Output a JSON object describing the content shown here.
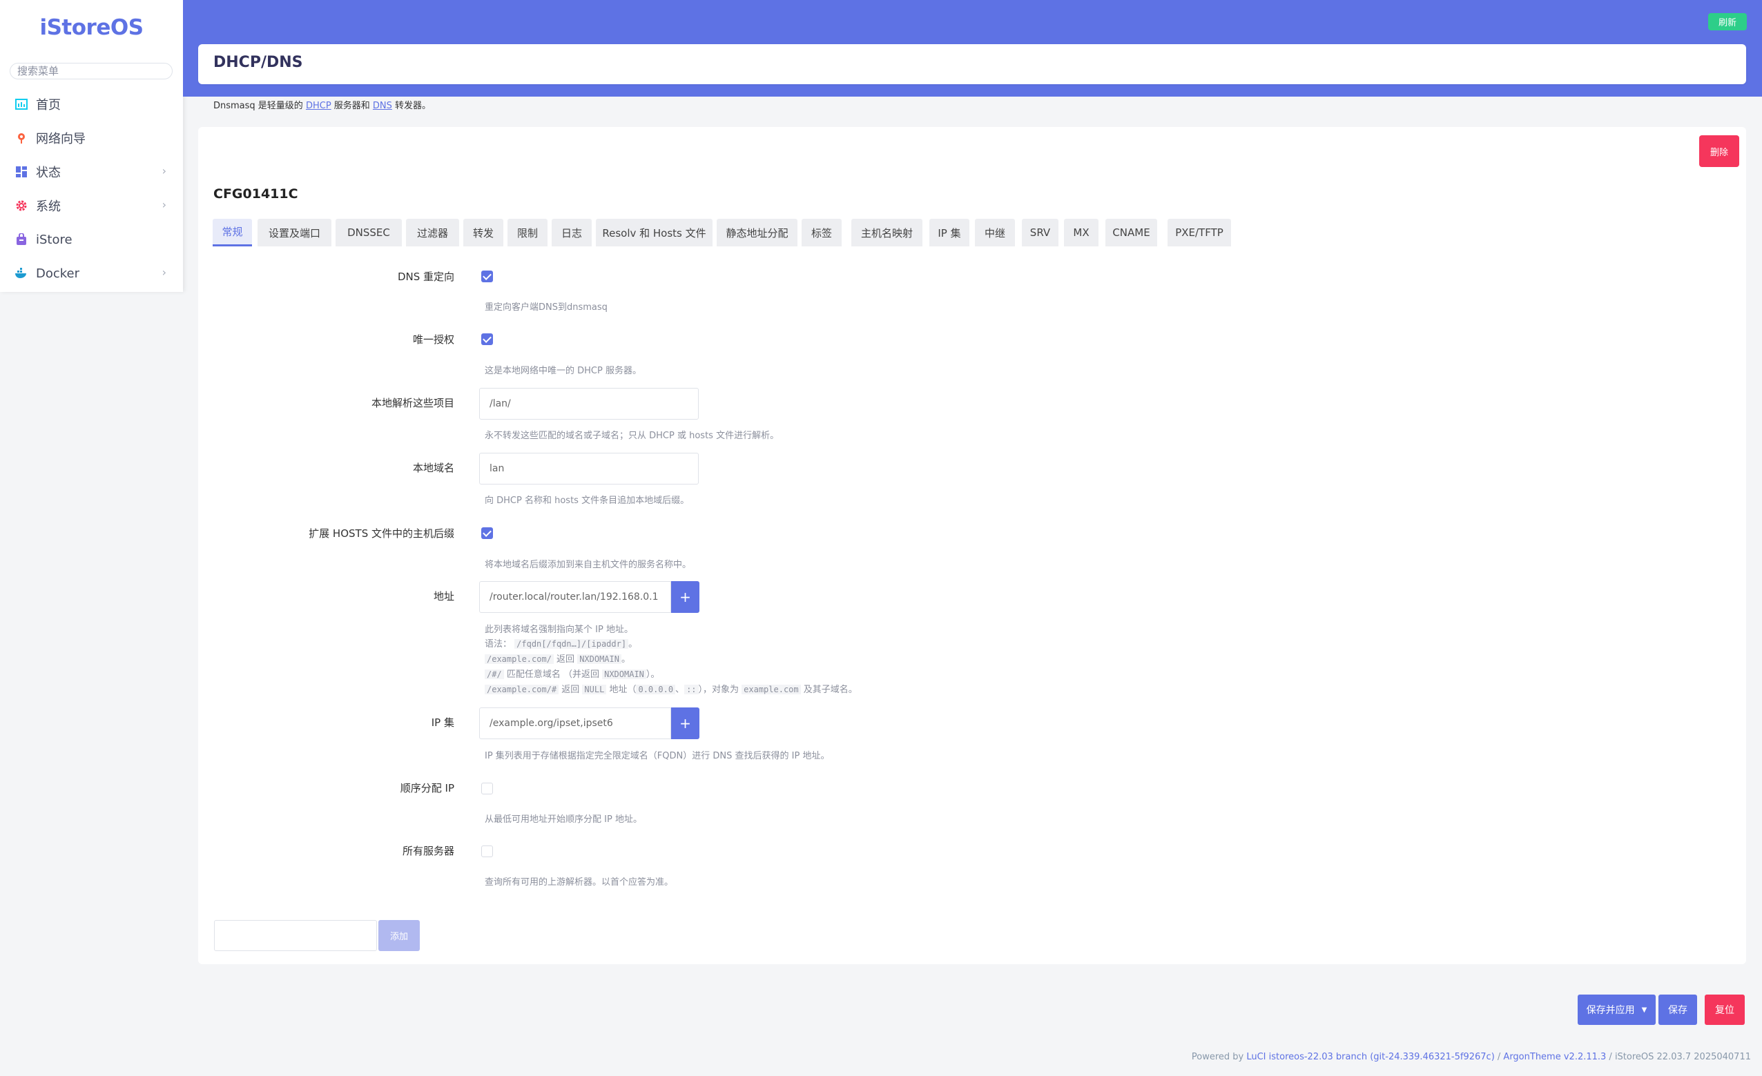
{
  "brand": "iStoreOS",
  "search": {
    "placeholder": "搜索菜单"
  },
  "sidebar": {
    "items": [
      {
        "label": "首页",
        "icon": "home-icon"
      },
      {
        "label": "网络向导",
        "icon": "wizard-icon"
      },
      {
        "label": "状态",
        "icon": "status-icon",
        "expand": true
      },
      {
        "label": "系统",
        "icon": "system-gear-icon",
        "expand": true
      },
      {
        "label": "iStore",
        "icon": "store-icon"
      },
      {
        "label": "Docker",
        "icon": "docker-icon",
        "expand": true
      }
    ]
  },
  "header": {
    "refresh": "刷新",
    "title": "DHCP/DNS"
  },
  "description": {
    "prefix": "Dnsmasq 是轻量级的 ",
    "dhcp": "DHCP",
    "middle": " 服务器和 ",
    "dns": "DNS",
    "suffix": " 转发器。"
  },
  "section": {
    "title": "CFG01411C",
    "delete": "删除"
  },
  "tabs": [
    "常规",
    "设置及端口",
    "DNSSEC",
    "过滤器",
    "转发",
    "限制",
    "日志",
    "Resolv 和 Hosts 文件",
    "静态地址分配",
    "标签",
    "主机名映射",
    "IP 集",
    "中继",
    "SRV",
    "MX",
    "CNAME",
    "PXE/TFTP"
  ],
  "fields": {
    "dns_redirect": {
      "label": "DNS 重定向",
      "checked": true,
      "help": "重定向客户端DNS到dnsmasq"
    },
    "authoritative": {
      "label": "唯一授权",
      "checked": true,
      "help": "这是本地网络中唯一的 DHCP 服务器。"
    },
    "local": {
      "label": "本地解析这些项目",
      "placeholder": "/lan/",
      "help": "永不转发这些匹配的域名或子域名；只从 DHCP 或 hosts 文件进行解析。"
    },
    "domain": {
      "label": "本地域名",
      "placeholder": "lan",
      "help": "向 DHCP 名称和 hosts 文件条目追加本地域后缀。"
    },
    "expandhosts": {
      "label": "扩展 HOSTS 文件中的主机后缀",
      "checked": true,
      "help": "将本地域名后缀添加到来自主机文件的服务名称中。"
    },
    "address": {
      "label": "地址",
      "placeholder": "/router.local/router.lan/192.168.0.1",
      "add": "+",
      "help1": "此列表将域名强制指向某个 IP 地址。",
      "help2_pre": "语法： ",
      "help2_code": "/fqdn[/fqdn…]/[ipaddr]",
      "help2_post": "。",
      "help3_code": "/example.com/",
      "help3_mid": " 返回 ",
      "help3_code2": "NXDOMAIN",
      "help3_post": "。",
      "help4_code": "/#/",
      "help4_mid": " 匹配任意域名 （并返回 ",
      "help4_code2": "NXDOMAIN",
      "help4_post": "）。",
      "help5_code": "/example.com/#",
      "help5_mid": " 返回 ",
      "help5_code2": "NULL",
      "help5_mid2": " 地址（",
      "help5_code3": "0.0.0.0",
      "help5_sep": "、",
      "help5_code4": "::",
      "help5_mid3": "），对象为 ",
      "help5_code5": "example.com",
      "help5_post": " 及其子域名。"
    },
    "ipset": {
      "label": "IP 集",
      "placeholder": "/example.org/ipset,ipset6",
      "add": "+",
      "help": "IP 集列表用于存储根据指定完全限定域名（FQDN）进行 DNS 查找后获得的 IP 地址。"
    },
    "sequential_ip": {
      "label": "顺序分配 IP",
      "checked": false,
      "help": "从最低可用地址开始顺序分配 IP 地址。"
    },
    "allservers": {
      "label": "所有服务器",
      "checked": false,
      "help": "查询所有可用的上游解析器。以首个应答为准。"
    }
  },
  "add_section": {
    "button": "添加"
  },
  "actions": {
    "save_apply": "保存并应用",
    "save": "保存",
    "reset": "复位"
  },
  "footer": {
    "powered": "Powered by ",
    "luci": "LuCI istoreos-22.03 branch (git-24.339.46321-5f9267c)",
    "sep": " / ",
    "theme": "ArgonTheme v2.2.11.3",
    "version": " / iStoreOS 22.03.7 2025040711"
  },
  "colors": {
    "accent": "#5e72e4",
    "success": "#2dce89",
    "danger": "#f5365c"
  }
}
